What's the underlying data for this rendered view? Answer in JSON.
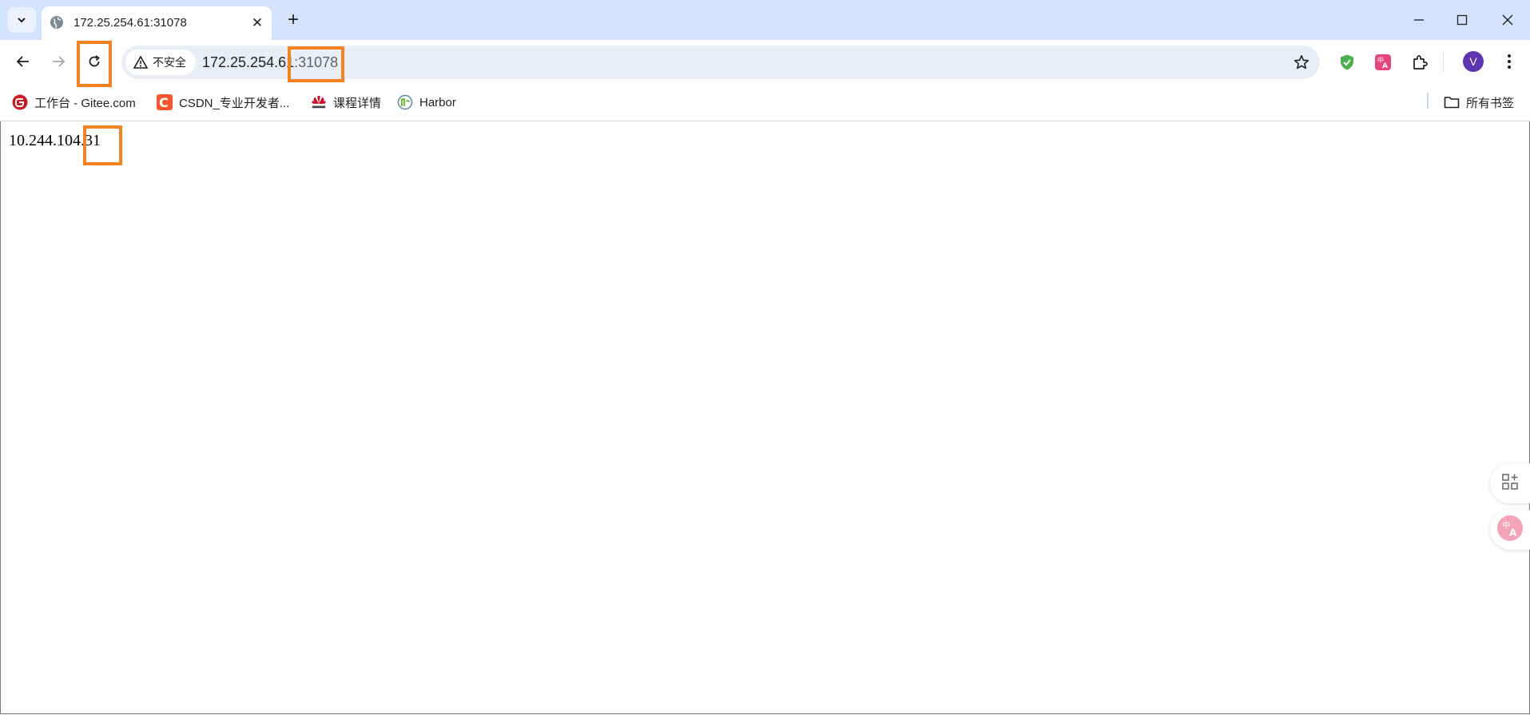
{
  "tab": {
    "title": "172.25.254.61:31078",
    "close_glyph": "✕"
  },
  "new_tab_glyph": "+",
  "window_controls": {
    "minimize": "—",
    "maximize": "☐",
    "close": "✕"
  },
  "omnibox": {
    "security_label": "不安全",
    "url_host": "172.25.254.61",
    "url_port": ":31078"
  },
  "profile": {
    "initial": "V",
    "color": "#5e35b1"
  },
  "bookmarks": [
    {
      "label": "工作台 - Gitee.com",
      "icon": "gitee-icon",
      "color": "#c71d23"
    },
    {
      "label": "CSDN_专业开发者...",
      "icon": "csdn-icon",
      "color": "#fc5531"
    },
    {
      "label": "课程详情",
      "icon": "huawei-icon",
      "color": "#cf0a2c"
    },
    {
      "label": "Harbor",
      "icon": "harbor-icon",
      "color": "#60b932"
    }
  ],
  "all_bookmarks_label": "所有书签",
  "page": {
    "text": "10.244.104.31"
  },
  "highlight_color": "#f58220"
}
